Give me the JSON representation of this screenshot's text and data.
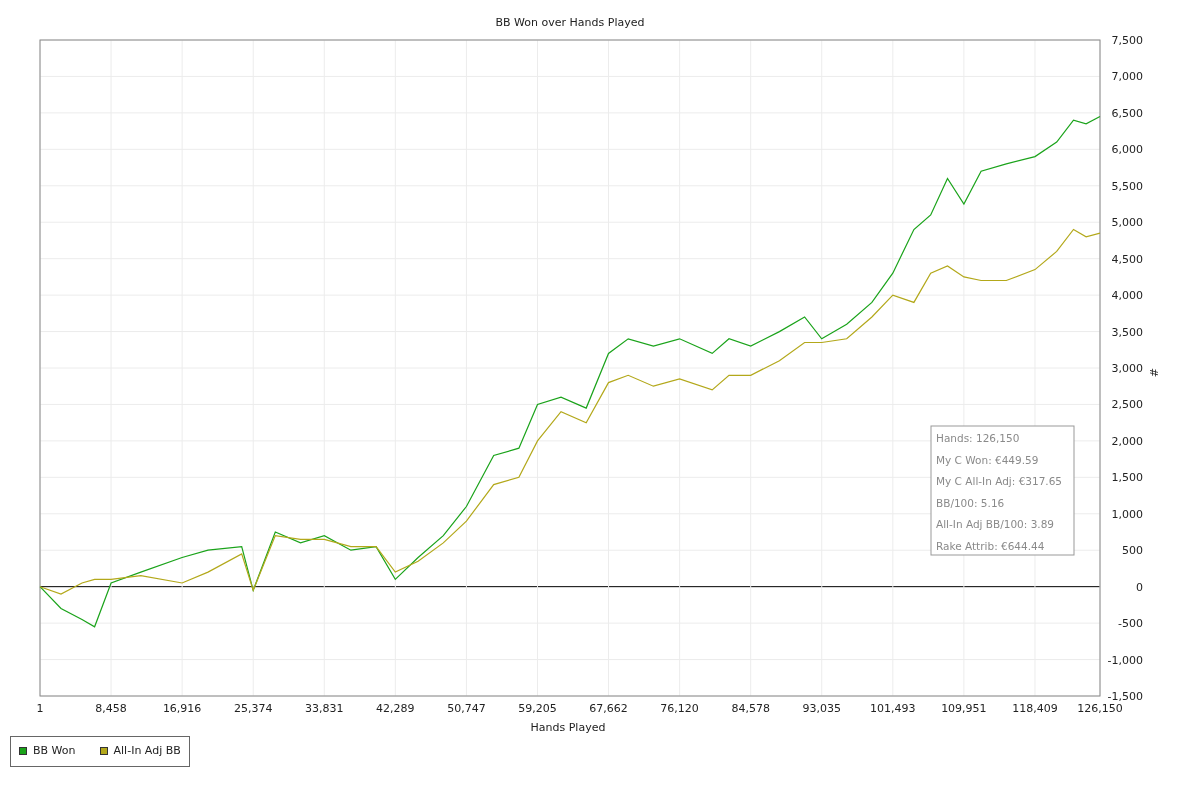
{
  "chart_data": {
    "type": "line",
    "title": "BB Won over Hands Played",
    "xlabel": "Hands Played",
    "ylabel": "#",
    "x": [
      1,
      2500,
      5000,
      6500,
      8458,
      12000,
      16916,
      20000,
      24000,
      25374,
      28000,
      31000,
      33831,
      37000,
      40000,
      42289,
      45000,
      48000,
      50747,
      54000,
      57000,
      59205,
      62000,
      65000,
      67662,
      70000,
      73000,
      76120,
      80000,
      82000,
      84578,
      88000,
      91000,
      93035,
      96000,
      99000,
      101493,
      104000,
      106000,
      108000,
      109951,
      112000,
      115000,
      118409,
      121000,
      123000,
      124500,
      126150
    ],
    "series": [
      {
        "name": "BB Won",
        "color": "#1aa31a",
        "values": [
          0,
          -300,
          -450,
          -550,
          50,
          200,
          400,
          500,
          550,
          -50,
          750,
          600,
          700,
          500,
          550,
          100,
          400,
          700,
          1100,
          1800,
          1900,
          2500,
          2600,
          2450,
          3200,
          3400,
          3300,
          3400,
          3200,
          3400,
          3300,
          3500,
          3700,
          3400,
          3600,
          3900,
          4300,
          4900,
          5100,
          5600,
          5250,
          5700,
          5800,
          5900,
          6100,
          6400,
          6350,
          6450
        ]
      },
      {
        "name": "All-In Adj BB",
        "color": "#b3a81a",
        "values": [
          0,
          -100,
          50,
          100,
          100,
          150,
          50,
          200,
          450,
          -50,
          700,
          650,
          650,
          550,
          550,
          200,
          350,
          600,
          900,
          1400,
          1500,
          2000,
          2400,
          2250,
          2800,
          2900,
          2750,
          2850,
          2700,
          2900,
          2900,
          3100,
          3350,
          3350,
          3400,
          3700,
          4000,
          3900,
          4300,
          4400,
          4250,
          4200,
          4200,
          4350,
          4600,
          4900,
          4800,
          4850
        ]
      }
    ],
    "grid": true,
    "legend": true,
    "xlim": [
      1,
      126150
    ],
    "ylim": [
      -1500,
      7500
    ],
    "xticks": [
      {
        "value": 1,
        "label": "1"
      },
      {
        "value": 8458,
        "label": "8,458"
      },
      {
        "value": 16916,
        "label": "16,916"
      },
      {
        "value": 25374,
        "label": "25,374"
      },
      {
        "value": 33831,
        "label": "33,831"
      },
      {
        "value": 42289,
        "label": "42,289"
      },
      {
        "value": 50747,
        "label": "50,747"
      },
      {
        "value": 59205,
        "label": "59,205"
      },
      {
        "value": 67662,
        "label": "67,662"
      },
      {
        "value": 76120,
        "label": "76,120"
      },
      {
        "value": 84578,
        "label": "84,578"
      },
      {
        "value": 93035,
        "label": "93,035"
      },
      {
        "value": 101493,
        "label": "101,493"
      },
      {
        "value": 109951,
        "label": "109,951"
      },
      {
        "value": 118409,
        "label": "118,409"
      },
      {
        "value": 126150,
        "label": "126,150"
      }
    ],
    "yticks": [
      {
        "value": -1500,
        "label": "-1,500"
      },
      {
        "value": -1000,
        "label": "-1,000"
      },
      {
        "value": -500,
        "label": "-500"
      },
      {
        "value": 0,
        "label": "0"
      },
      {
        "value": 500,
        "label": "500"
      },
      {
        "value": 1000,
        "label": "1,000"
      },
      {
        "value": 1500,
        "label": "1,500"
      },
      {
        "value": 2000,
        "label": "2,000"
      },
      {
        "value": 2500,
        "label": "2,500"
      },
      {
        "value": 3000,
        "label": "3,000"
      },
      {
        "value": 3500,
        "label": "3,500"
      },
      {
        "value": 4000,
        "label": "4,000"
      },
      {
        "value": 4500,
        "label": "4,500"
      },
      {
        "value": 5000,
        "label": "5,000"
      },
      {
        "value": 5500,
        "label": "5,500"
      },
      {
        "value": 6000,
        "label": "6,000"
      },
      {
        "value": 6500,
        "label": "6,500"
      },
      {
        "value": 7000,
        "label": "7,000"
      },
      {
        "value": 7500,
        "label": "7,500"
      }
    ],
    "annotations": [
      "Hands: 126,150",
      "My C Won: €449.59",
      "My C All-In Adj: €317.65",
      "BB/100: 5.16",
      "All-In Adj BB/100: 3.89",
      "Rake Attrib: €644.44"
    ]
  }
}
